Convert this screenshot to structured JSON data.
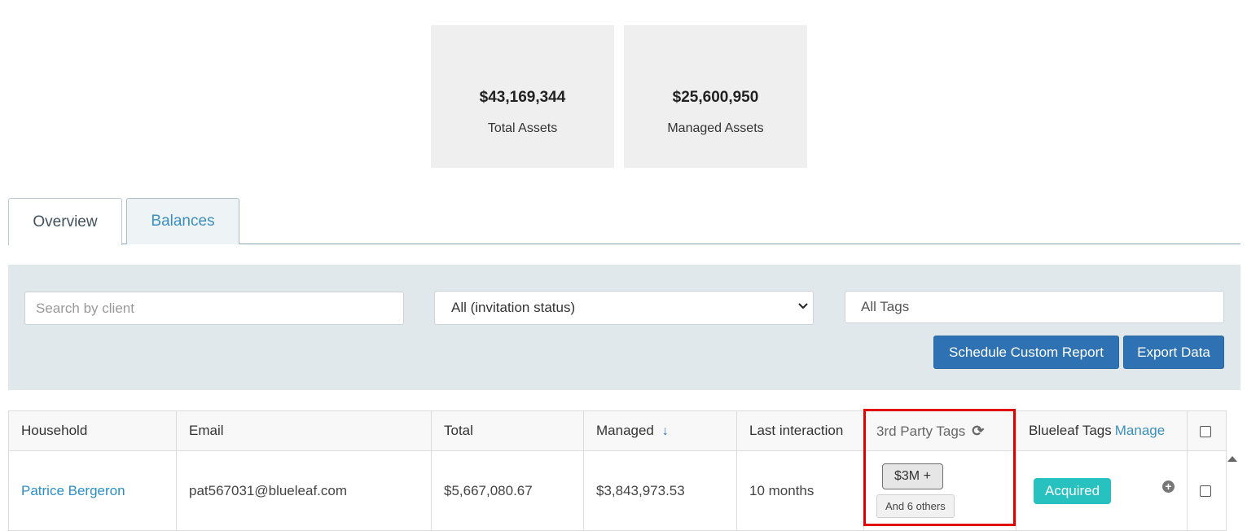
{
  "stats": {
    "total_assets": {
      "value": "$43,169,344",
      "label": "Total Assets"
    },
    "managed_assets": {
      "value": "$25,600,950",
      "label": "Managed Assets"
    }
  },
  "tabs": [
    {
      "label": "Overview",
      "active": true
    },
    {
      "label": "Balances",
      "active": false
    }
  ],
  "filters": {
    "search_placeholder": "Search by client",
    "status_select": "All (invitation status)",
    "tags_placeholder": "All Tags",
    "schedule_button": "Schedule Custom Report",
    "export_button": "Export Data"
  },
  "table": {
    "headers": {
      "household": "Household",
      "email": "Email",
      "total": "Total",
      "managed": "Managed",
      "last_interaction": "Last interaction",
      "third_party_tags": "3rd Party Tags",
      "blueleaf_tags": "Blueleaf Tags",
      "manage_link": "Manage"
    },
    "rows": [
      {
        "household": "Patrice Bergeron",
        "email": "pat567031@blueleaf.com",
        "total": "$5,667,080.67",
        "managed": "$3,843,973.53",
        "last_interaction": "10 months",
        "third_party_tag": "$3M +",
        "third_party_others": "And 6 others",
        "blueleaf_tag": "Acquired"
      }
    ]
  },
  "icons": {
    "refresh": "refresh-icon",
    "sort": "sort-down-arrow-icon",
    "add": "plus-circle-icon",
    "dropdown": "chevron-down-icon"
  },
  "colors": {
    "primary_button": "#2f72b3",
    "link": "#2b8fc7",
    "acquired_badge": "#27c1c0",
    "highlight": "#e00000",
    "filter_bar": "#e1e8ec"
  }
}
